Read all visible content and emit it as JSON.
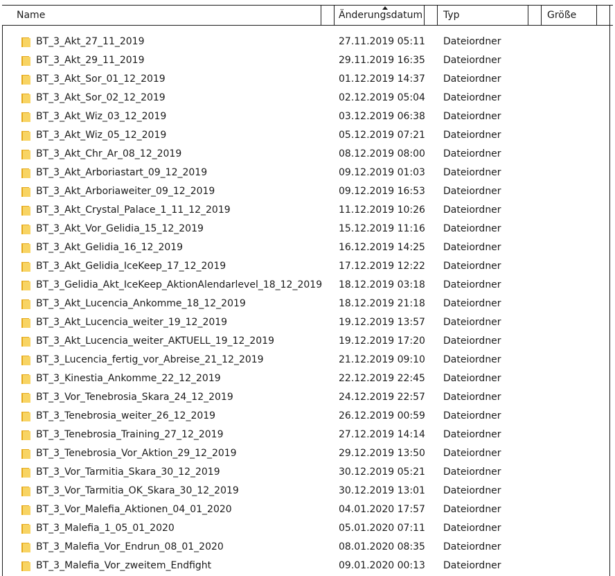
{
  "columns": {
    "name": "Name",
    "date": "Änderungsdatum",
    "type": "Typ",
    "size": "Größe"
  },
  "sort": {
    "column": "Änderungsdatum",
    "direction": "ascending",
    "icon": "sort-up-icon"
  },
  "folder_icon": {
    "name": "folder-icon",
    "color_front": "#f8d463",
    "color_back": "#e5a91c"
  },
  "files": [
    {
      "name": "BT_3_Akt_27_11_2019",
      "date": "27.11.2019 05:11",
      "type": "Dateiordner",
      "size": ""
    },
    {
      "name": "BT_3_Akt_29_11_2019",
      "date": "29.11.2019 16:35",
      "type": "Dateiordner",
      "size": ""
    },
    {
      "name": "BT_3_Akt_Sor_01_12_2019",
      "date": "01.12.2019 14:37",
      "type": "Dateiordner",
      "size": ""
    },
    {
      "name": "BT_3_Akt_Sor_02_12_2019",
      "date": "02.12.2019 05:04",
      "type": "Dateiordner",
      "size": ""
    },
    {
      "name": "BT_3_Akt_Wiz_03_12_2019",
      "date": "03.12.2019 06:38",
      "type": "Dateiordner",
      "size": ""
    },
    {
      "name": "BT_3_Akt_Wiz_05_12_2019",
      "date": "05.12.2019 07:21",
      "type": "Dateiordner",
      "size": ""
    },
    {
      "name": "BT_3_Akt_Chr_Ar_08_12_2019",
      "date": "08.12.2019 08:00",
      "type": "Dateiordner",
      "size": ""
    },
    {
      "name": "BT_3_Akt_Arboriastart_09_12_2019",
      "date": "09.12.2019 01:03",
      "type": "Dateiordner",
      "size": ""
    },
    {
      "name": "BT_3_Akt_Arboriaweiter_09_12_2019",
      "date": "09.12.2019 16:53",
      "type": "Dateiordner",
      "size": ""
    },
    {
      "name": "BT_3_Akt_Crystal_Palace_1_11_12_2019",
      "date": "11.12.2019 10:26",
      "type": "Dateiordner",
      "size": ""
    },
    {
      "name": "BT_3_Akt_Vor_Gelidia_15_12_2019",
      "date": "15.12.2019 11:16",
      "type": "Dateiordner",
      "size": ""
    },
    {
      "name": "BT_3_Akt_Gelidia_16_12_2019",
      "date": "16.12.2019 14:25",
      "type": "Dateiordner",
      "size": ""
    },
    {
      "name": "BT_3_Akt_Gelidia_IceKeep_17_12_2019",
      "date": "17.12.2019 12:22",
      "type": "Dateiordner",
      "size": ""
    },
    {
      "name": "BT_3_Gelidia_Akt_IceKeep_AktionAlendarlevel_18_12_2019",
      "date": "18.12.2019 03:18",
      "type": "Dateiordner",
      "size": ""
    },
    {
      "name": "BT_3_Akt_Lucencia_Ankomme_18_12_2019",
      "date": "18.12.2019 21:18",
      "type": "Dateiordner",
      "size": ""
    },
    {
      "name": "BT_3_Akt_Lucencia_weiter_19_12_2019",
      "date": "19.12.2019 13:57",
      "type": "Dateiordner",
      "size": ""
    },
    {
      "name": "BT_3_Akt_Lucencia_weiter_AKTUELL_19_12_2019",
      "date": "19.12.2019 17:20",
      "type": "Dateiordner",
      "size": ""
    },
    {
      "name": "BT_3_Lucencia_fertig_vor_Abreise_21_12_2019",
      "date": "21.12.2019 09:10",
      "type": "Dateiordner",
      "size": ""
    },
    {
      "name": "BT_3_Kinestia_Ankomme_22_12_2019",
      "date": "22.12.2019 22:45",
      "type": "Dateiordner",
      "size": ""
    },
    {
      "name": "BT_3_Vor_Tenebrosia_Skara_24_12_2019",
      "date": "24.12.2019 22:57",
      "type": "Dateiordner",
      "size": ""
    },
    {
      "name": "BT_3_Tenebrosia_weiter_26_12_2019",
      "date": "26.12.2019 00:59",
      "type": "Dateiordner",
      "size": ""
    },
    {
      "name": "BT_3_Tenebrosia_Training_27_12_2019",
      "date": "27.12.2019 14:14",
      "type": "Dateiordner",
      "size": ""
    },
    {
      "name": "BT_3_Tenebrosia_Vor_Aktion_29_12_2019",
      "date": "29.12.2019 13:50",
      "type": "Dateiordner",
      "size": ""
    },
    {
      "name": "BT_3_Vor_Tarmitia_Skara_30_12_2019",
      "date": "30.12.2019 05:21",
      "type": "Dateiordner",
      "size": ""
    },
    {
      "name": "BT_3_Vor_Tarmitia_OK_Skara_30_12_2019",
      "date": "30.12.2019 13:01",
      "type": "Dateiordner",
      "size": ""
    },
    {
      "name": "BT_3_Vor_Malefia_Aktionen_04_01_2020",
      "date": "04.01.2020 17:57",
      "type": "Dateiordner",
      "size": ""
    },
    {
      "name": "BT_3_Malefia_1_05_01_2020",
      "date": "05.01.2020 07:11",
      "type": "Dateiordner",
      "size": ""
    },
    {
      "name": "BT_3_Malefia_Vor_Endrun_08_01_2020",
      "date": "08.01.2020 08:35",
      "type": "Dateiordner",
      "size": ""
    },
    {
      "name": "BT_3_Malefia_Vor_zweitem_Endfight",
      "date": "09.01.2020 00:13",
      "type": "Dateiordner",
      "size": ""
    }
  ]
}
